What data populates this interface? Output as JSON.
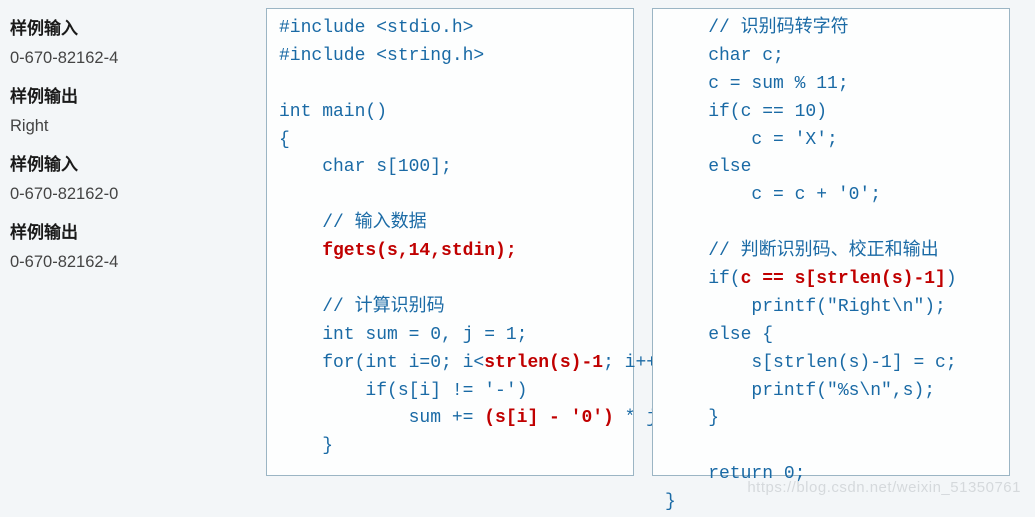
{
  "left": {
    "h1": "样例输入",
    "v1": "0-670-82162-4",
    "h2": "样例输出",
    "v2": "Right",
    "h3": "样例输入",
    "v3": "0-670-82162-0",
    "h4": "样例输出",
    "v4": "0-670-82162-4"
  },
  "code1": {
    "l1": "#include <stdio.h>",
    "l2": "#include <string.h>",
    "l3": "",
    "l4": "int main()",
    "l5": "{",
    "l6": "    char s[100];",
    "l7": "",
    "l8": "    // 输入数据",
    "l9": "    fgets(s,14,stdin);",
    "l10": "",
    "l11": "    // 计算识别码",
    "l12": "    int sum = 0, j = 1;",
    "l13a": "    for(int i=0; i<",
    "l13b": "strlen(s)-1",
    "l13c": "; i++) {",
    "l14": "        if(s[i] != '-')",
    "l15a": "            sum += ",
    "l15b": "(s[i] - '0')",
    "l15c": " * j++;",
    "l16": "    }"
  },
  "code2": {
    "l1": "    // 识别码转字符",
    "l2": "    char c;",
    "l3": "    c = sum % 11;",
    "l4": "    if(c == 10)",
    "l5": "        c = 'X';",
    "l6": "    else",
    "l7": "        c = c + '0';",
    "l8": "",
    "l9": "    // 判断识别码、校正和输出",
    "l10a": "    if(",
    "l10b": "c == s[strlen(s)-1]",
    "l10c": ")",
    "l11": "        printf(\"Right\\n\");",
    "l12": "    else {",
    "l13": "        s[strlen(s)-1] = c;",
    "l14": "        printf(\"%s\\n\",s);",
    "l15": "    }",
    "l16": "",
    "l17": "    return 0;",
    "l18": "}"
  },
  "watermark": "https://blog.csdn.net/weixin_51350761"
}
